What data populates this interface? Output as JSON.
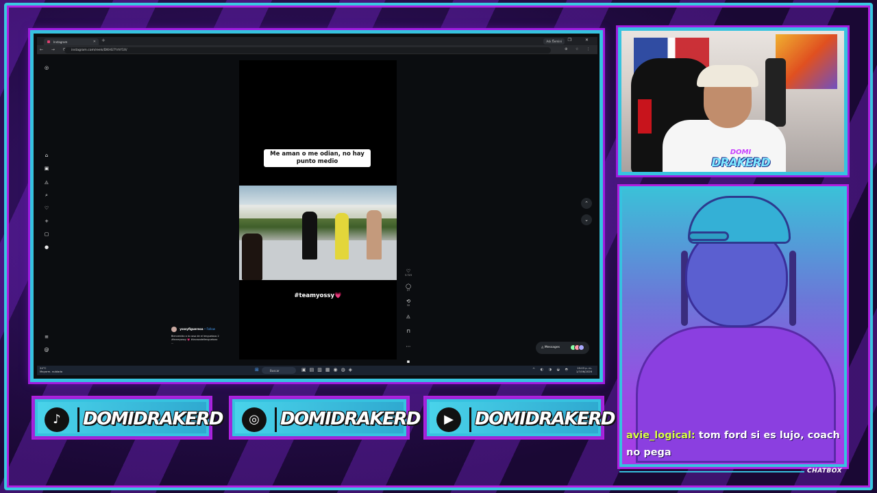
{
  "browser": {
    "tab_title": "Instagram",
    "new_tab": "+",
    "gemini_label": "Ask Gemini",
    "window_controls": "– ❐ ✕",
    "nav_buttons": "← → ⟳",
    "url": "instagram.com/reels/DKHG7YrhY1X/",
    "url_icons": "⊕ ☆ ⋮"
  },
  "instagram": {
    "sidebar_icons": [
      "instagram-logo-icon",
      "home-icon",
      "reels-icon",
      "explore-icon",
      "search-icon",
      "heart-icon",
      "create-icon",
      "dashboard-icon",
      "profile-icon",
      "menu-icon",
      "threads-icon"
    ],
    "reel_caption": "Me aman o me odian, no hay punto medio",
    "hashtag": "#teamyossy💗",
    "actions": {
      "likes": "3.723",
      "comments": "27",
      "reposts": "32"
    },
    "author": {
      "username": "yossyfiguereoa",
      "follow": "• Follow",
      "description_line1": "Bienvenido a la casa de el lenguetazo 2",
      "description_line2": "#teamyossy 💗 #lacasadellenguetazo",
      "more": "..."
    },
    "messages_label": "Messages"
  },
  "taskbar": {
    "weather_temp": "24°C",
    "weather_desc": "Mayorm. nublado",
    "search_placeholder": "Buscar",
    "time": "19:03 p. m.",
    "date": "1/7/06/2026"
  },
  "webcam": {
    "logo_line1": "DOMI",
    "logo_line2": "DRAKERD"
  },
  "chat": {
    "username": "avie_logical:",
    "message": " tom ford si es lujo, coach no pega",
    "label": "CHATBOX"
  },
  "socials": [
    {
      "platform": "tiktok",
      "icon": "tiktok-icon",
      "glyph": "♪",
      "handle": "DOMIDRAKERD"
    },
    {
      "platform": "instagram",
      "icon": "instagram-icon",
      "glyph": "◎",
      "handle": "DOMIDRAKERD"
    },
    {
      "platform": "youtube",
      "icon": "youtube-icon",
      "glyph": "▶",
      "handle": "DOMIDRAKERD"
    }
  ],
  "colors": {
    "frame_cyan": "#36c3df",
    "frame_purple": "#a01ce0",
    "chat_username": "#d8ff44"
  }
}
